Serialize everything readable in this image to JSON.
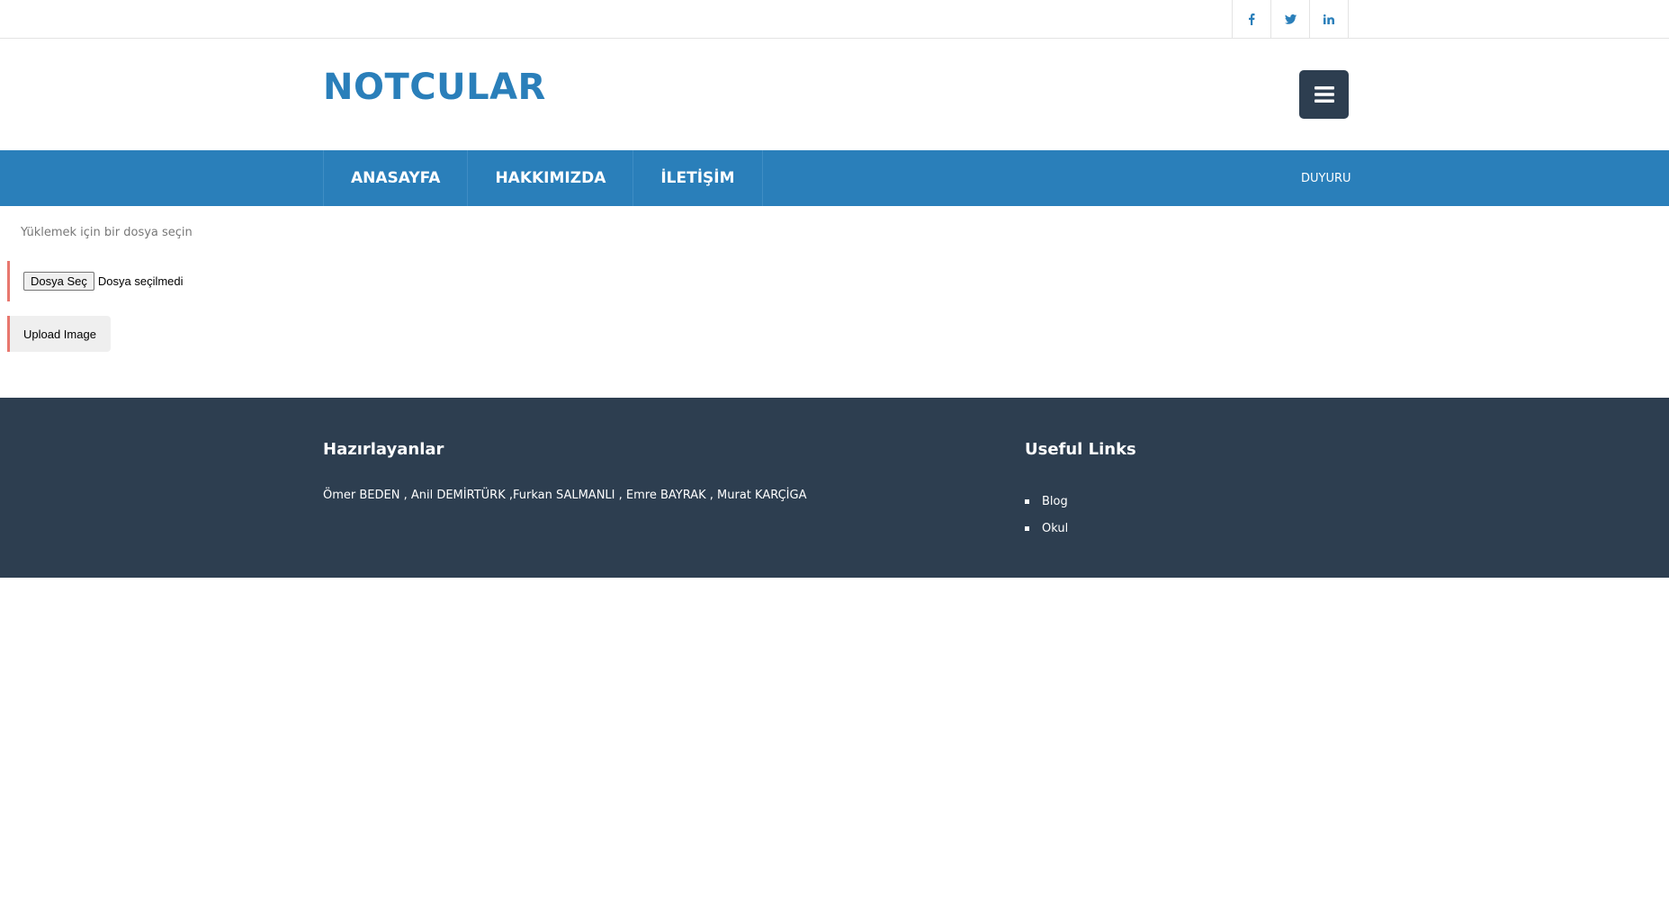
{
  "social": {
    "facebook_icon": "facebook-icon",
    "twitter_icon": "twitter-icon",
    "linkedin_icon": "linkedin-icon"
  },
  "header": {
    "logo": "NOTCULAR",
    "menu_icon": "hamburger-menu-icon"
  },
  "nav": {
    "items": [
      {
        "label": "ANASAYFA"
      },
      {
        "label": "HAKKIMIZDA"
      },
      {
        "label": "İLETİŞİM"
      }
    ],
    "right_label": "DUYURU"
  },
  "content": {
    "upload_label": "Yüklemek için bir dosya seçin",
    "file_button": "Dosya Seç",
    "file_status": "Dosya seçilmedi",
    "upload_button": "Upload Image"
  },
  "footer": {
    "col1_title": "Hazırlayanlar",
    "authors": "Ömer BEDEN , Anil DEMİRTÜRK ,Furkan SALMANLI , Emre BAYRAK , Murat KARÇİGA",
    "col2_title": "Useful Links",
    "links": [
      {
        "label": "Blog"
      },
      {
        "label": "Okul"
      }
    ]
  },
  "colors": {
    "brand_blue": "#2a7fba",
    "dark_navy": "#2d3e50",
    "accent_red": "#e8776e"
  }
}
